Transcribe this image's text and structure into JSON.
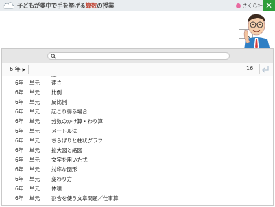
{
  "app": {
    "title_pre": "子どもが夢中で手を挙げる",
    "title_accent": "算数",
    "title_post": "の授業",
    "brand": "さくら社",
    "close": "✕"
  },
  "filter": {
    "grade": "6 年",
    "count": "16"
  },
  "rows": [
    {
      "grade": "",
      "type": "",
      "title": "速"
    },
    {
      "grade": "6年",
      "type": "単元",
      "title": "速さ"
    },
    {
      "grade": "6年",
      "type": "単元",
      "title": "比例"
    },
    {
      "grade": "6年",
      "type": "単元",
      "title": "反比例"
    },
    {
      "grade": "6年",
      "type": "単元",
      "title": "起こり得る場合"
    },
    {
      "grade": "6年",
      "type": "単元",
      "title": "分数のかけ算・わり算"
    },
    {
      "grade": "6年",
      "type": "単元",
      "title": "メートル法"
    },
    {
      "grade": "6年",
      "type": "単元",
      "title": "ちらばりと柱状グラフ"
    },
    {
      "grade": "6年",
      "type": "単元",
      "title": "拡大図と縮図"
    },
    {
      "grade": "6年",
      "type": "単元",
      "title": "文字を用いた式"
    },
    {
      "grade": "6年",
      "type": "単元",
      "title": "対称な図形"
    },
    {
      "grade": "6年",
      "type": "単元",
      "title": "変わり方"
    },
    {
      "grade": "6年",
      "type": "単元",
      "title": "体積"
    },
    {
      "grade": "6年",
      "type": "単元",
      "title": "割合を使う文章問題／仕事算"
    }
  ]
}
